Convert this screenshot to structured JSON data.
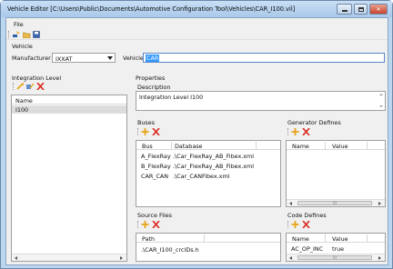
{
  "window": {
    "title": "Vehicle Editor [C:\\Users\\Public\\Documents\\Automotive Configuration Tool\\Vehicles\\CAR_I100.vil]",
    "minimize_icon": "minimize-icon",
    "maximize_icon": "maximize-icon",
    "close_icon": "close-icon"
  },
  "menu": {
    "file": "File"
  },
  "toolbar": {
    "icons": [
      "new-vehicle-icon",
      "open-folder-icon",
      "save-disk-icon"
    ]
  },
  "vehicle": {
    "group_label": "Vehicle",
    "manufacturer_label": "Manufacturer",
    "manufacturer_value": "IXXAT",
    "vehicle_label": "Vehicle",
    "vehicle_value": "CAR"
  },
  "integration": {
    "group_label": "Integration Level",
    "column": "Name",
    "items": [
      "I100"
    ],
    "icons": [
      "add-level-icon",
      "edit-level-icon",
      "delete-icon"
    ]
  },
  "properties": {
    "group_label": "Properties",
    "description_label": "Description",
    "description_value": "Integration Level I100"
  },
  "buses": {
    "label": "Buses",
    "columns": [
      "Bus",
      "Database"
    ],
    "rows": [
      {
        "bus": "A_FlexRay",
        "db": ".\\Car_FlexRay_AB_Fibex.xml"
      },
      {
        "bus": "B_FlexRay",
        "db": ".\\Car_FlexRay_AB_Fibex.xml"
      },
      {
        "bus": "CAR_CAN",
        "db": ".\\Car_CANFibex.xml"
      }
    ]
  },
  "generator_defines": {
    "label": "Generator Defines",
    "columns": [
      "Name",
      "Value"
    ],
    "scroll_label": "III"
  },
  "source_files": {
    "label": "Source Files",
    "columns": [
      "Path"
    ],
    "rows": [
      ".\\CAR_I100_crcIDs.h"
    ]
  },
  "code_defines": {
    "label": "Code Defines",
    "columns": [
      "Name",
      "Value"
    ],
    "rows": [
      {
        "name": "AC_OP_INC",
        "value": "true"
      }
    ],
    "scroll_label": "III"
  },
  "colors": {
    "add": "#e8a317",
    "delete": "#d9261c",
    "selection": "#3399ff",
    "title_bg": "#bcd6ef"
  }
}
